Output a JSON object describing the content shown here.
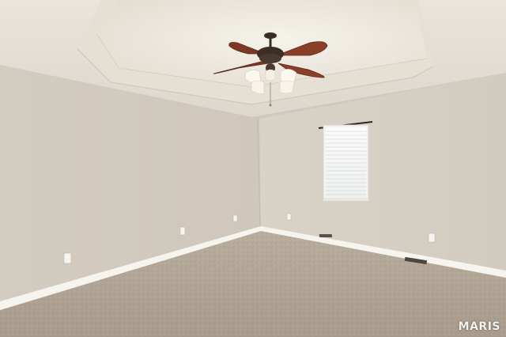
{
  "watermark": {
    "text": "MARIS"
  },
  "colors": {
    "ceiling": "#ebe6dc",
    "tray": "#f3efe6",
    "wall_left": "#d6cfc4",
    "wall_right": "#dcd5ca",
    "carpet": "#b3a696",
    "baseboard": "#f7f6f2",
    "fan_blade": "#8a3f28",
    "fan_body": "#3b2e27"
  }
}
